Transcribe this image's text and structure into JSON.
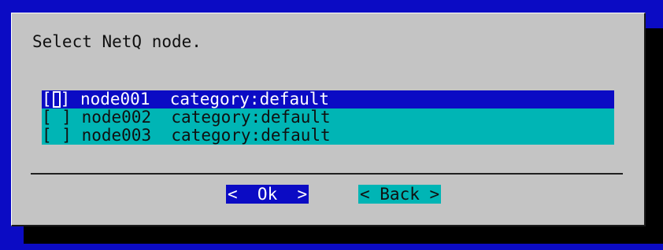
{
  "dialog": {
    "prompt": "Select NetQ node.",
    "nodes": [
      {
        "checkbox_open": "[",
        "checkbox_close": "]",
        "name": "node001",
        "category": "category:default",
        "selected": true
      },
      {
        "checkbox": "[ ]",
        "name": "node002",
        "category": "category:default",
        "selected": false
      },
      {
        "checkbox": "[ ]",
        "name": "node003",
        "category": "category:default",
        "selected": false
      }
    ],
    "buttons": {
      "ok": "<  Ok  >",
      "back": "< Back >"
    }
  },
  "colors": {
    "background": "#0b0bc4",
    "dialog": "#c4c4c4",
    "highlight": "#0b0bc4",
    "list_item": "#00b5b5",
    "shadow": "#000000"
  }
}
